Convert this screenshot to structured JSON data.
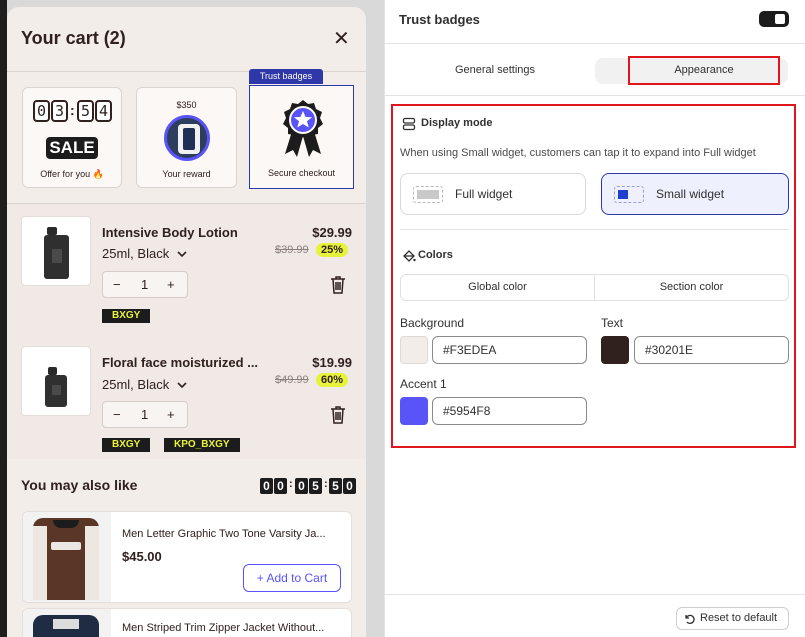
{
  "cart": {
    "title": "Your cart (2)",
    "close_glyph": "✕",
    "trust_badges_tag": "Trust badges",
    "tiles": [
      {
        "timer": [
          "0",
          "3",
          "5",
          "4"
        ],
        "sale": "SALE",
        "caption": "Offer for you 🔥"
      },
      {
        "amount": "$350",
        "caption": "Your reward"
      },
      {
        "caption": "Secure checkout"
      }
    ],
    "items": [
      {
        "name": "Intensive Body Lotion",
        "variant": "25ml, Black",
        "price": "$29.99",
        "compare": "$39.99",
        "discount": "25%",
        "qty": "1",
        "tags": [
          "BXGY"
        ]
      },
      {
        "name": "Floral face moisturized ...",
        "variant": "25ml, Black",
        "price": "$19.99",
        "compare": "$49.99",
        "discount": "60%",
        "qty": "1",
        "tags": [
          "BXGY",
          "KPO_BXGY"
        ]
      }
    ],
    "stepper_minus": "−",
    "stepper_plus": "+",
    "upsell": {
      "title": "You may also like",
      "timer": [
        "0",
        "0",
        "0",
        "5",
        "5",
        "0"
      ],
      "products": [
        {
          "name": "Men Letter Graphic Two Tone Varsity Ja...",
          "price": "$45.00",
          "button": "Add to Cart"
        },
        {
          "name": "Men Striped Trim Zipper Jacket Without..."
        }
      ]
    }
  },
  "settings": {
    "title": "Trust badges",
    "tabs": [
      "General settings",
      "Appearance"
    ],
    "display_mode": {
      "heading": "Display mode",
      "help": "When using Small widget, customers can tap it to expand into Full widget",
      "options": [
        "Full widget",
        "Small widget"
      ],
      "selected": "Small widget"
    },
    "colors": {
      "heading": "Colors",
      "tabs": [
        "Global color",
        "Section color"
      ],
      "fields": [
        {
          "label": "Background",
          "value": "#F3EDEA",
          "swatch": "#F3EDEA"
        },
        {
          "label": "Text",
          "value": "#30201E",
          "swatch": "#30201E"
        },
        {
          "label": "Accent 1",
          "value": "#5954F8",
          "swatch": "#5954F8"
        }
      ]
    },
    "reset": "Reset to default"
  },
  "icons": [
    "close-icon",
    "chevron-down-icon",
    "trash-icon",
    "ribbon-badge-icon",
    "display-mode-icon",
    "paint-bucket-icon",
    "reset-icon",
    "toggle-switch",
    "plus-icon"
  ],
  "colors": {
    "accent": "#5954F8",
    "highlight": "#E7F23B",
    "brand_dark": "#30201E",
    "focus_red": "#E0161E",
    "selected_blue": "#2F38A8"
  }
}
